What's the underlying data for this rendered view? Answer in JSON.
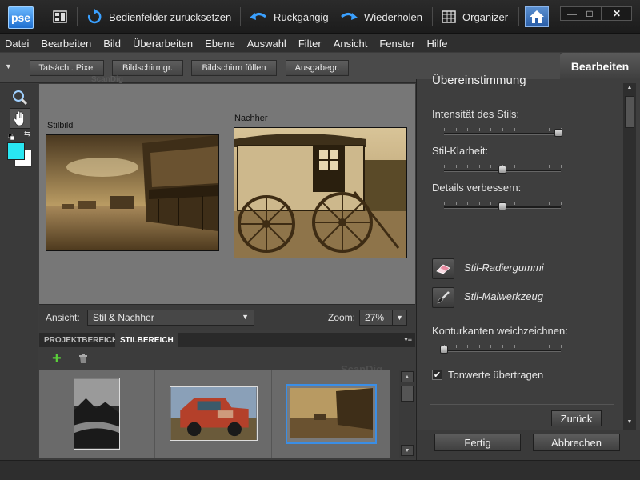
{
  "titlebar": {
    "logo": "pse",
    "reset_panels": "Bedienfelder zurücksetzen",
    "undo": "Rückgängig",
    "redo": "Wiederholen",
    "organizer": "Organizer",
    "min": "—",
    "max": "□",
    "close": "✕"
  },
  "menu": [
    "Datei",
    "Bearbeiten",
    "Bild",
    "Überarbeiten",
    "Ebene",
    "Auswahl",
    "Filter",
    "Ansicht",
    "Fenster",
    "Hilfe"
  ],
  "options": {
    "actual_pixels": "Tatsächl. Pixel",
    "fit_screen": "Bildschirmgr.",
    "fill_screen": "Bildschirm füllen",
    "print_size": "Ausgabegr.",
    "watermark": "ScanDig"
  },
  "mode_tab": "Bearbeiten",
  "canvas": {
    "style_label": "Stilbild",
    "after_label": "Nachher"
  },
  "viewbar": {
    "view_label": "Ansicht:",
    "view_value": "Stil & Nachher",
    "zoom_label": "Zoom:",
    "zoom_value": "27%"
  },
  "bins": {
    "project_tab": "PROJEKTBEREICH",
    "style_tab": "STILBEREICH",
    "watermark": "ScanDig"
  },
  "panel": {
    "section_title": "Übereinstimmung",
    "intensity_label": "Intensität des Stils:",
    "intensity": 0.98,
    "clarity_label": "Stil-Klarheit:",
    "clarity": 0.5,
    "details_label": "Details verbessern:",
    "details": 0.5,
    "eraser_label": "Stil-Radiergummi",
    "brush_label": "Stil-Malwerkzeug",
    "feather_label": "Konturkanten weichzeichnen:",
    "feather": 0.0,
    "transfer_tones_label": "Tonwerte übertragen",
    "transfer_tones_checked": true,
    "reset_button": "Zurück",
    "done_button": "Fertig",
    "cancel_button": "Abbrechen"
  },
  "colors": {
    "foreground": "#29e6f2",
    "background": "#ffffff",
    "accent_selected": "#3a8ee6"
  }
}
